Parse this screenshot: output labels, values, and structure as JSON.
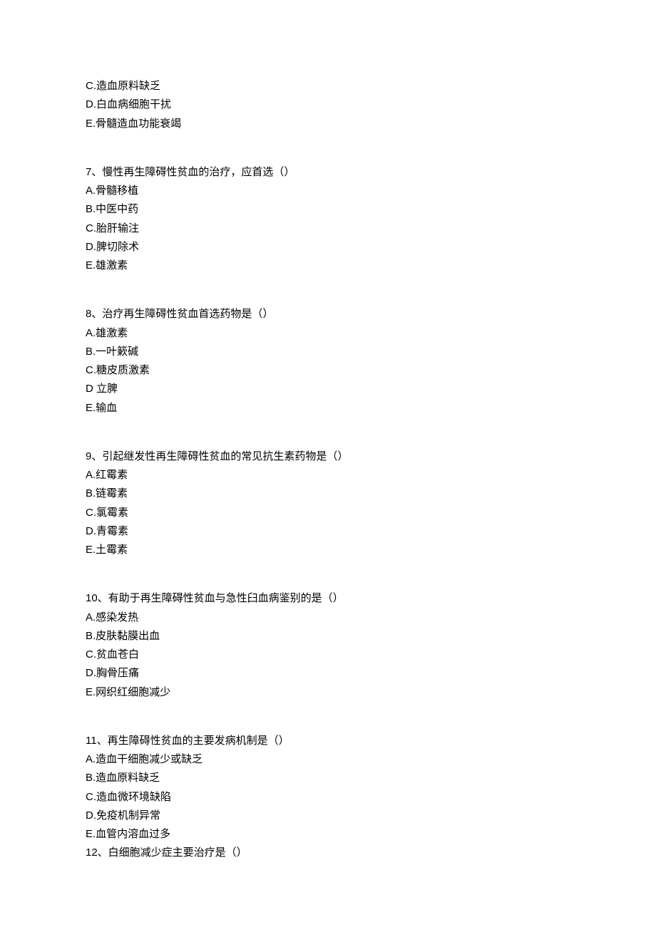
{
  "orphan_options": [
    "C.造血原料缺乏",
    "D.白血病细胞干扰",
    "E.骨髓造血功能衰竭"
  ],
  "questions": [
    {
      "stem": "7、慢性再生障碍性贫血的治疗，应首选（）",
      "options": [
        "A.骨髓移植",
        "B.中医中药",
        "C.胎肝输注",
        "D.脾切除术",
        "E.雄激素"
      ]
    },
    {
      "stem": "8、治疗再生障碍性贫血首选药物是（）",
      "options": [
        "A.雄激素",
        "B.一叶簌碱",
        "C.糖皮质激素",
        "D 立脾",
        "E.输血"
      ]
    },
    {
      "stem": "9、引起继发性再生障碍性贫血的常见抗生素药物是（）",
      "options": [
        "A.红霉素",
        "B.链霉素",
        "C.氯霉素",
        "D.青霉素",
        "E.土霉素"
      ]
    },
    {
      "stem": "10、有助于再生障碍性贫血与急性臼血病鉴别的是（）",
      "options": [
        "A.感染发热",
        "B.皮肤黏膜出血",
        "C.贫血苍白",
        "D.胸骨压痛",
        "E.网织红细胞减少"
      ]
    },
    {
      "stem": "11、再生障碍性贫血的主要发病机制是（）",
      "options": [
        "A.造血干细胞减少或缺乏",
        "B.造血原料缺乏",
        "C.造血微环境缺陷",
        "D.免疫机制异常",
        "E.血管内溶血过多"
      ]
    },
    {
      "stem": "12、白细胞减少症主要治疗是（）",
      "options": []
    }
  ]
}
